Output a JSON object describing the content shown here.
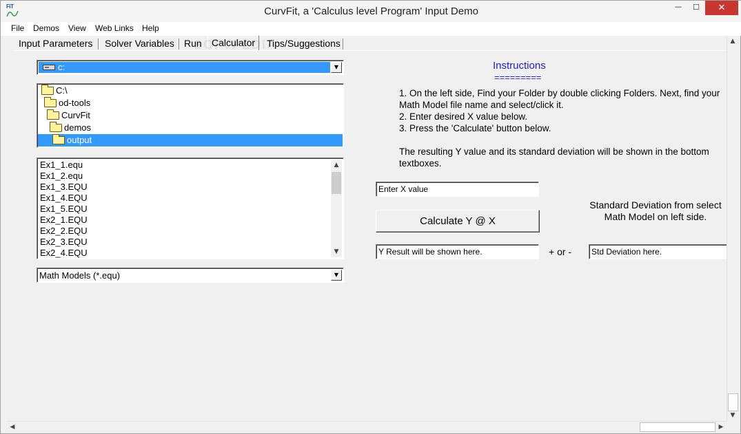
{
  "window": {
    "title": "CurvFit, a 'Calculus level Program' Input Demo",
    "icon_text": "FiT",
    "minimize_glyph": "—",
    "maximize_glyph": "☐",
    "close_glyph": "✕"
  },
  "menu": {
    "items": [
      "File",
      "Demos",
      "View",
      "Web Links",
      "Help"
    ]
  },
  "tabs": [
    {
      "label": "Input Parameters",
      "active": false
    },
    {
      "label": "Solver Variables",
      "active": false
    },
    {
      "label": "Run",
      "active": false
    },
    {
      "label": "Calculator",
      "active": true
    },
    {
      "label": "Tips/Suggestions",
      "active": false
    }
  ],
  "watermark": "SOFTPEDIA",
  "drive_combo": {
    "value": "c:",
    "icon": "drive-icon"
  },
  "folders": [
    {
      "label": "C:\\",
      "selected": false
    },
    {
      "label": "od-tools",
      "selected": false
    },
    {
      "label": "CurvFit",
      "selected": false
    },
    {
      "label": "demos",
      "selected": false
    },
    {
      "label": "output",
      "selected": true
    }
  ],
  "files": [
    "Ex1_1.equ",
    "Ex1_2.equ",
    "Ex1_3.EQU",
    "Ex1_4.EQU",
    "Ex1_5.EQU",
    "Ex2_1.EQU",
    "Ex2_2.EQU",
    "Ex2_3.EQU",
    "Ex2_4.EQU"
  ],
  "file_type_combo": {
    "value": "Math Models (*.equ)"
  },
  "instructions": {
    "title": "Instructions",
    "underline": "=========",
    "step1": "1. On the left side, Find your Folder by double clicking Folders. Next, find your Math Model file name and select/click it.",
    "step2": "2. Enter desired X value below.",
    "step3": "3. Press the 'Calculate' button below.",
    "note": "The resulting Y value and its standard deviation will be shown in the bottom textboxes."
  },
  "calculator": {
    "x_input_value": "Enter X value",
    "calculate_label": "Calculate Y @ X",
    "y_result_value": "Y Result will be shown here.",
    "or_label": "+ or -",
    "std_label": "Standard Deviation from select Math Model on left side.",
    "std_value": "Std Deviation here."
  },
  "scroll_glyphs": {
    "up": "▲",
    "down": "▼",
    "left": "◀",
    "right": "▶",
    "combo": "▼"
  },
  "colors": {
    "selection": "#3399ff",
    "instructions_title": "#1c1ccc",
    "close_button": "#c7372f"
  }
}
